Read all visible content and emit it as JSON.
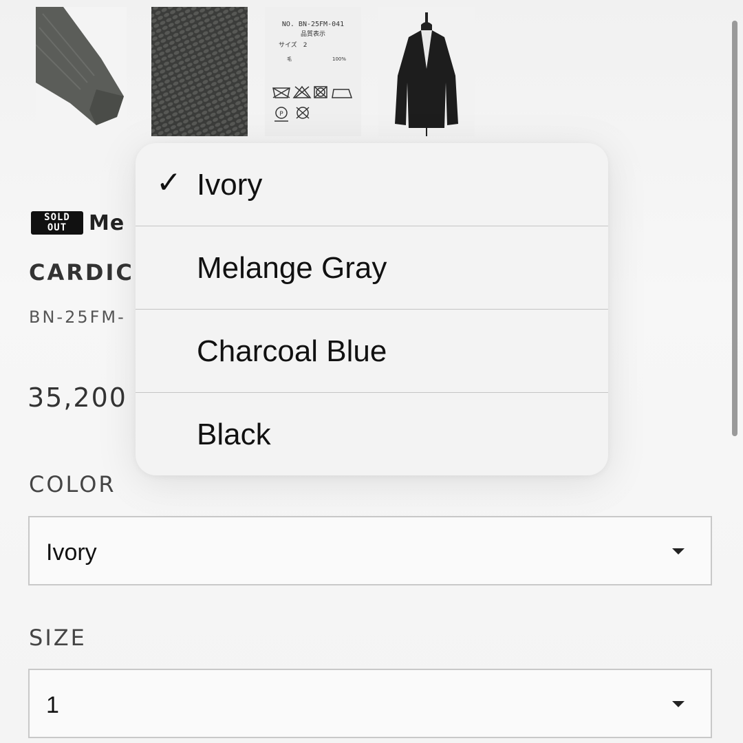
{
  "gallery": {
    "tag_image": {
      "line1": "NO. BN-25FM-041",
      "line2": "品質表示",
      "line3": "サイズ　2",
      "line4_left": "毛",
      "line4_right": "100%"
    }
  },
  "product": {
    "badge_line1": "SOLD",
    "badge_line2": "OUT",
    "name_visible": "Me",
    "category_visible": "CARDIC",
    "code_visible": "BN-25FM-",
    "price_visible": "35,200"
  },
  "color_field": {
    "label": "COLOR",
    "selected": "Ivory"
  },
  "size_field": {
    "label": "SIZE",
    "selected": "1"
  },
  "color_dropdown": {
    "checkmark": "✓",
    "options": [
      {
        "label": "Ivory",
        "checked": true
      },
      {
        "label": "Melange Gray",
        "checked": false
      },
      {
        "label": "Charcoal Blue",
        "checked": false
      },
      {
        "label": "Black",
        "checked": false
      }
    ]
  },
  "colors": {
    "background": "#f6f6f6",
    "text": "#222222",
    "border": "#c8c8c8",
    "menu_bg": "#f3f3f3"
  }
}
